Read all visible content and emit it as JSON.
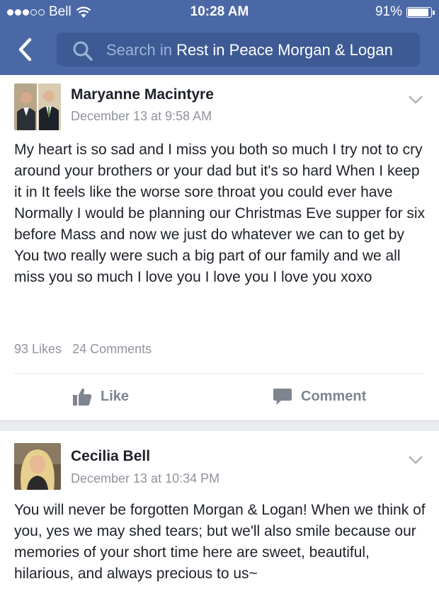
{
  "status_bar": {
    "carrier": "Bell",
    "time": "10:28 AM",
    "battery": "91%",
    "battery_level": 0.91,
    "signal_bars": 3
  },
  "search": {
    "prefix": "Search in ",
    "query": "Rest in Peace Morgan & Logan"
  },
  "icons": {
    "back": "chevron-left-icon",
    "search": "search-icon",
    "wifi": "wifi-icon",
    "battery": "battery-icon",
    "menu": "chevron-down-icon",
    "like": "thumbs-up-icon",
    "comment": "comment-bubble-icon"
  },
  "colors": {
    "header": "#4b68a6",
    "search_bg": "#3d5a94",
    "muted": "#90949c",
    "action": "#7f8590"
  },
  "posts": [
    {
      "author": "Maryanne Macintyre",
      "date": "December 13 at 9:58 AM",
      "text": "My heart is so sad and I miss you both so much  I try not to cry around your brothers or your dad but it's so hard When I keep it in  It feels like the worse sore throat you could  ever have Normally I would be planning our Christmas Eve supper for six before Mass and now we just do whatever we can to get by  You two really were such a big part of our family and we all miss you so much I love you I love you I love you xoxo",
      "likes": "93 Likes",
      "comments": "24 Comments",
      "like_label": "Like",
      "comment_label": "Comment"
    },
    {
      "author": "Cecilia Bell",
      "date": "December 13 at 10:34 PM",
      "text": "You will never be forgotten Morgan & Logan! When we think of you, yes we may shed tears; but we'll also smile because our memories of your short time here are sweet, beautiful, hilarious, and always precious to us~"
    }
  ]
}
